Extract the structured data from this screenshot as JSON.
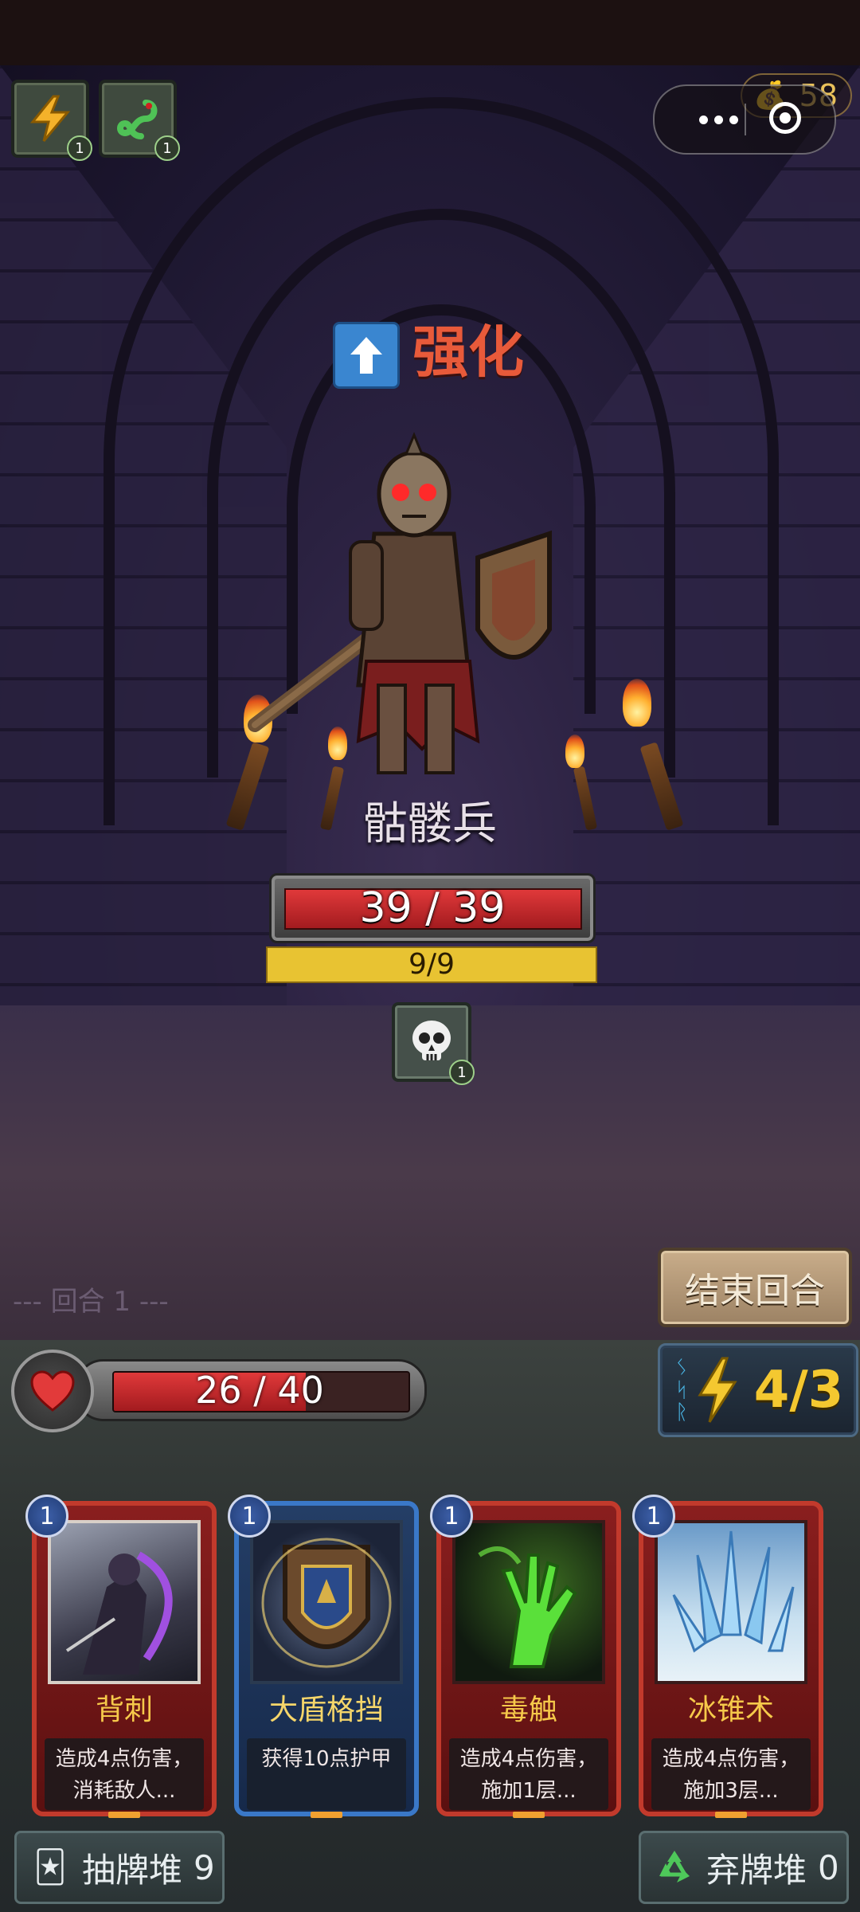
{
  "topbar": {},
  "buffs": [
    {
      "icon": "lightning-icon",
      "glyph": "⚡",
      "stack": "1"
    },
    {
      "icon": "snake-icon",
      "glyph": "ᘏ",
      "stack": "1"
    }
  ],
  "gold": {
    "value": "58",
    "icon": "money-bag-icon"
  },
  "miniprogram": {
    "menu_icon": "more-dots-icon",
    "close_icon": "target-close-icon"
  },
  "enemy": {
    "intent_label": "强化",
    "intent_icon": "arrow-up-icon",
    "name": "骷髅兵",
    "hp_text": "39 / 39",
    "hp_fraction": 1.0,
    "shield_text": "9/9",
    "debuffs": [
      {
        "icon": "skull-icon",
        "stack": "1"
      }
    ]
  },
  "round_text": "--- 回合 1 ---",
  "end_turn_label": "结束回合",
  "player": {
    "hp_text": "26 / 40",
    "hp_fraction": 0.65,
    "energy_text": "4/3"
  },
  "cards": [
    {
      "cost": "1",
      "name": "背刺",
      "desc_line1": "造成4点伤害，",
      "desc_line2": "消耗敌人...",
      "color": "red"
    },
    {
      "cost": "1",
      "name": "大盾格挡",
      "desc_line1": "获得10点护甲",
      "desc_line2": "",
      "color": "blue"
    },
    {
      "cost": "1",
      "name": "毒触",
      "desc_line1": "造成4点伤害，",
      "desc_line2": "施加1层...",
      "color": "red"
    },
    {
      "cost": "1",
      "name": "冰锥术",
      "desc_line1": "造成4点伤害，",
      "desc_line2": "施加3层...",
      "color": "red"
    }
  ],
  "draw_pile": {
    "label": "抽牌堆",
    "count": "9"
  },
  "discard_pile": {
    "label": "弃牌堆",
    "count": "0"
  },
  "colors": {
    "accent_red": "#c23a2c",
    "accent_blue": "#3a78c8",
    "gold": "#f4c830"
  }
}
